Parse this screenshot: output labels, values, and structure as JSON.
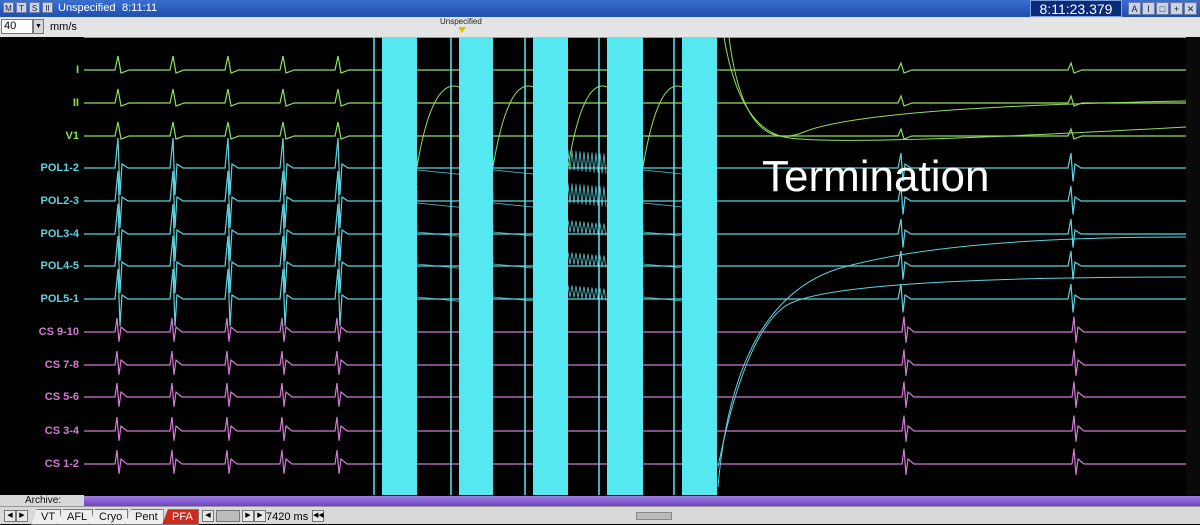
{
  "titlebar": {
    "buttons": [
      "M",
      "T",
      "S",
      "II"
    ],
    "title": "Unspecified",
    "time": "8:11:11",
    "clock": "8:11:23.379",
    "right_buttons": [
      "A",
      "I",
      "□",
      "+",
      "✕"
    ]
  },
  "speedbar": {
    "speed_value": "40",
    "speed_unit": "mm/s",
    "marker_label": "Unspecified"
  },
  "channels": [
    {
      "name": "I",
      "color": "#8fe05c",
      "group": "surface"
    },
    {
      "name": "II",
      "color": "#8fe05c",
      "group": "surface"
    },
    {
      "name": "V1",
      "color": "#8fe05c",
      "group": "surface"
    },
    {
      "name": "POL1-2",
      "color": "#5fd3e0",
      "group": "pol"
    },
    {
      "name": "POL2-3",
      "color": "#5fd3e0",
      "group": "pol"
    },
    {
      "name": "POL3-4",
      "color": "#5fd3e0",
      "group": "pol"
    },
    {
      "name": "POL4-5",
      "color": "#5fd3e0",
      "group": "pol"
    },
    {
      "name": "POL5-1",
      "color": "#5fd3e0",
      "group": "pol"
    },
    {
      "name": "CS 9-10",
      "color": "#d27ad4",
      "group": "cs"
    },
    {
      "name": "CS 7-8",
      "color": "#d27ad4",
      "group": "cs"
    },
    {
      "name": "CS 5-6",
      "color": "#d27ad4",
      "group": "cs"
    },
    {
      "name": "CS 3-4",
      "color": "#d27ad4",
      "group": "cs"
    },
    {
      "name": "CS 1-2",
      "color": "#d27ad4",
      "group": "cs"
    }
  ],
  "annotation": "Termination",
  "archive_label": "Archive:",
  "tabs": [
    "VT",
    "AFL",
    "Cryo",
    "Pent",
    "PFA"
  ],
  "active_tab": "PFA",
  "range_text": "7420 ms",
  "colors": {
    "pulse": "#55e8f0",
    "surface": "#8fe05c",
    "pol": "#5fd3e0",
    "cs": "#d27ad4",
    "active_tab": "#cc2b20"
  }
}
